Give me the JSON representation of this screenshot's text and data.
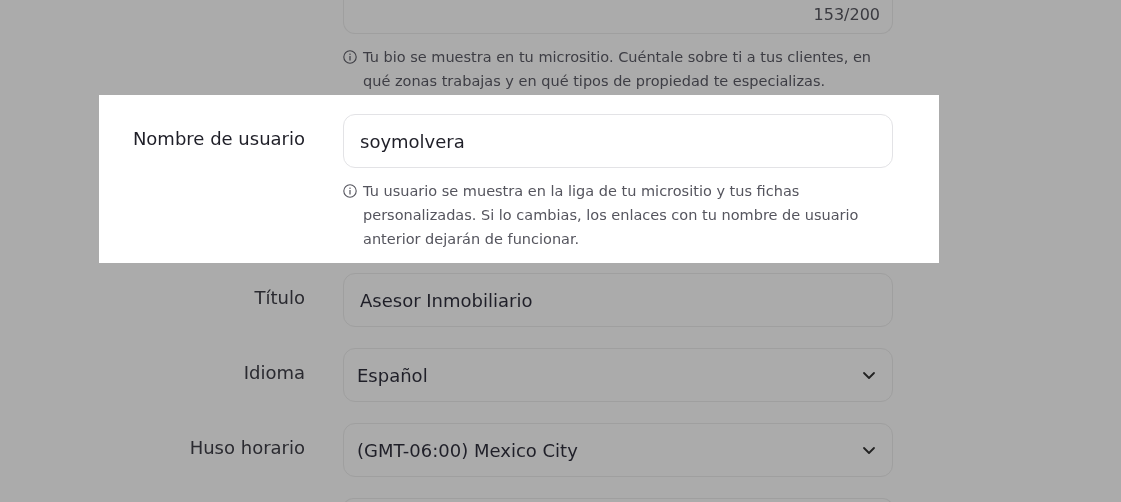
{
  "fields": [
    {
      "kind": "textarea",
      "highlighted": false,
      "counter": "153/200",
      "help": "Tu bio se muestra en tu micrositio. Cuéntale sobre ti a tus clientes, en qué zonas trabajas y en qué tipos de propiedad te especializas."
    },
    {
      "kind": "text",
      "highlighted": true,
      "label": "Nombre de usuario",
      "value": "soymolvera",
      "help": "Tu usuario se muestra en la liga de tu micrositio y tus fichas personalizadas. Si lo cambias, los enlaces con tu nombre de usuario anterior dejarán de funcionar."
    },
    {
      "kind": "text",
      "highlighted": false,
      "label": "Título",
      "value": "Asesor Inmobiliario"
    },
    {
      "kind": "select",
      "highlighted": false,
      "label": "Idioma",
      "value": "Español"
    },
    {
      "kind": "select",
      "highlighted": false,
      "label": "Huso horario",
      "value": "(GMT-06:00) Mexico City"
    },
    {
      "kind": "text",
      "highlighted": false
    }
  ]
}
